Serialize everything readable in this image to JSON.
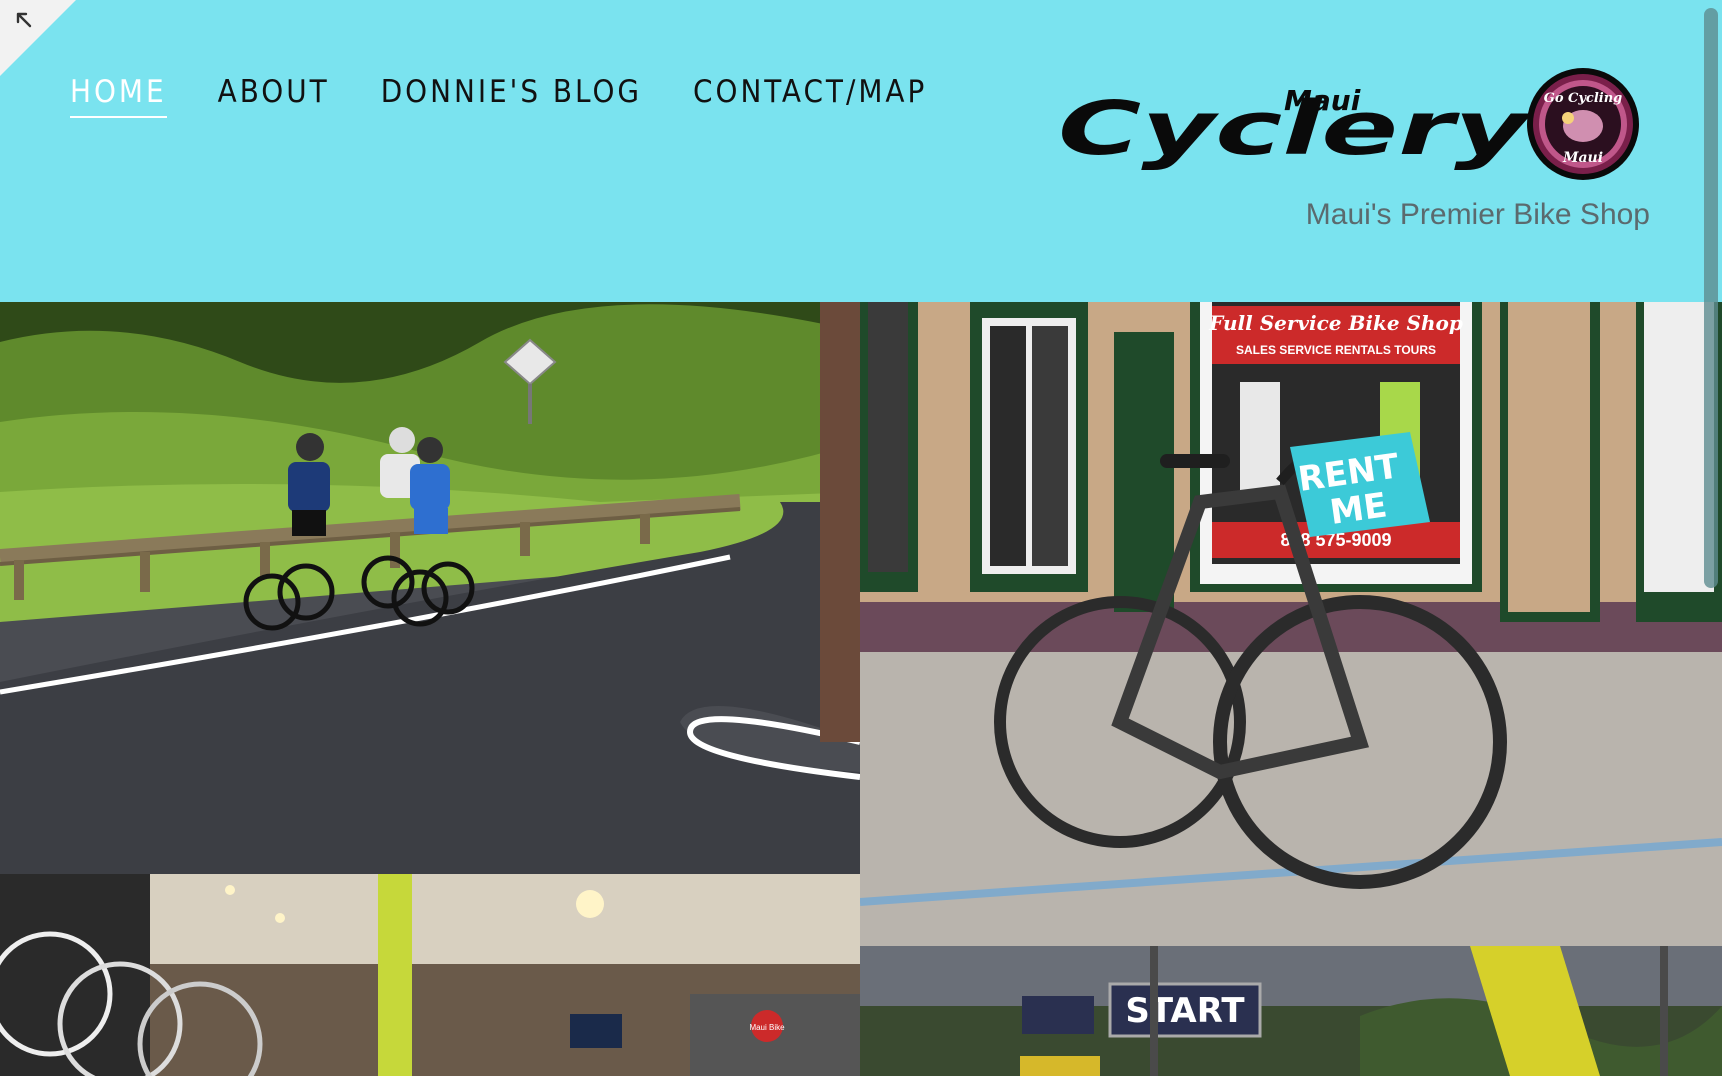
{
  "nav": {
    "items": [
      {
        "label": "HOME",
        "active": true
      },
      {
        "label": "ABOUT",
        "active": false
      },
      {
        "label": "DONNIE'S BLOG",
        "active": false
      },
      {
        "label": "CONTACT/MAP",
        "active": false
      }
    ]
  },
  "brand": {
    "logo_top": "Maui",
    "logo_main": "Cyclery",
    "badge_top": "Go Cycling",
    "badge_bottom": "Maui",
    "tagline": "Maui's Premier Bike Shop"
  },
  "photos": {
    "rentbike": {
      "window_sign": "Full Service Bike Shop",
      "window_services": "SALES   SERVICE   RENTALS   TOURS",
      "window_phone": "808 575-9009",
      "rent_sign_line1": "RENT",
      "rent_sign_line2": "ME"
    },
    "startline": {
      "banner_text": "START"
    },
    "shopinside": {
      "sign_text": "Maui Bike"
    }
  },
  "colors": {
    "background": "#7ae3ef",
    "nav_text": "#111111",
    "nav_active": "#ffffff",
    "tagline": "#5b6a6e"
  },
  "icons": {
    "corner": "expand-arrow-icon"
  }
}
